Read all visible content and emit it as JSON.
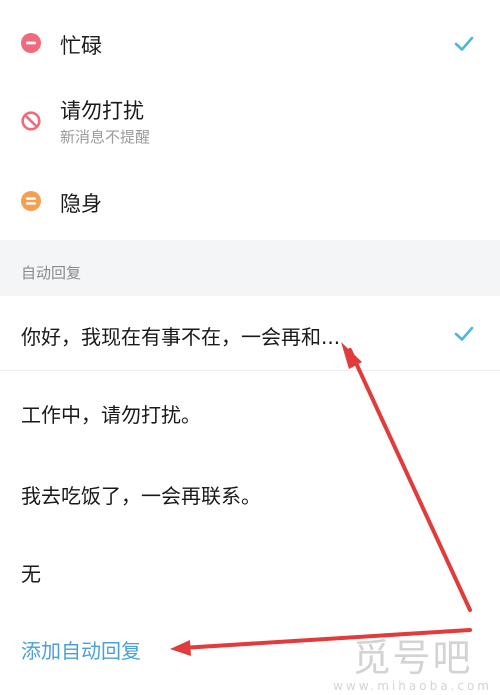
{
  "statuses": [
    {
      "label": "忙碌",
      "subtitle": "",
      "icon": "busy-minus-icon",
      "color": "#f16a7c",
      "selected": true
    },
    {
      "label": "请勿打扰",
      "subtitle": "新消息不提醒",
      "icon": "do-not-disturb-icon",
      "color": "#f16a7c",
      "selected": false
    },
    {
      "label": "隐身",
      "subtitle": "",
      "icon": "invisible-equals-icon",
      "color": "#f4a053",
      "selected": false
    }
  ],
  "auto_reply": {
    "section_title": "自动回复",
    "items": [
      {
        "text": "你好，我现在有事不在，一会再和...",
        "selected": true
      },
      {
        "text": "工作中，请勿打扰。",
        "selected": false
      },
      {
        "text": "我去吃饭了，一会再联系。",
        "selected": false
      },
      {
        "text": "无",
        "selected": false
      }
    ],
    "add_label": "添加自动回复"
  },
  "colors": {
    "check": "#4ab8dd",
    "link": "#4aa0d8",
    "arrow": "#e23b3b",
    "section_bg": "#f4f5f7"
  },
  "watermark": {
    "main": "觅号吧",
    "sub": "www.mihaoba.com"
  }
}
